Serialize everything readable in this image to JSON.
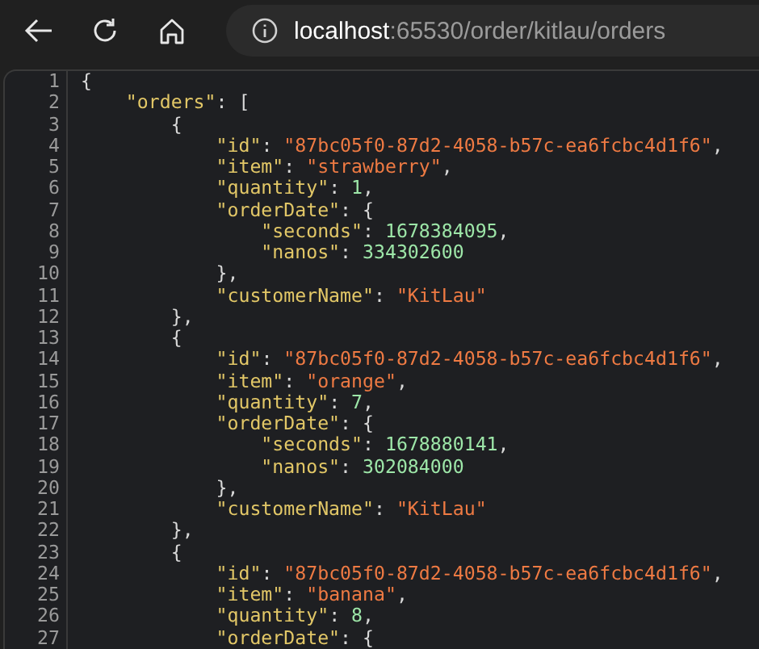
{
  "address_bar": {
    "host": "localhost",
    "path": ":65530/order/kitlau/orders"
  },
  "code_lines": [
    {
      "number": "1",
      "tokens": [
        {
          "kind": "punct",
          "text": "{"
        }
      ]
    },
    {
      "number": "2",
      "tokens": [
        {
          "kind": "key",
          "text": "    \"orders\""
        },
        {
          "kind": "punct",
          "text": ": ["
        }
      ]
    },
    {
      "number": "3",
      "tokens": [
        {
          "kind": "punct",
          "text": "        {"
        }
      ]
    },
    {
      "number": "4",
      "tokens": [
        {
          "kind": "key",
          "text": "            \"id\""
        },
        {
          "kind": "punct",
          "text": ": "
        },
        {
          "kind": "string",
          "text": "\"87bc05f0-87d2-4058-b57c-ea6fcbc4d1f6\""
        },
        {
          "kind": "punct",
          "text": ","
        }
      ]
    },
    {
      "number": "5",
      "tokens": [
        {
          "kind": "key",
          "text": "            \"item\""
        },
        {
          "kind": "punct",
          "text": ": "
        },
        {
          "kind": "string",
          "text": "\"strawberry\""
        },
        {
          "kind": "punct",
          "text": ","
        }
      ]
    },
    {
      "number": "6",
      "tokens": [
        {
          "kind": "key",
          "text": "            \"quantity\""
        },
        {
          "kind": "punct",
          "text": ": "
        },
        {
          "kind": "number",
          "text": "1"
        },
        {
          "kind": "punct",
          "text": ","
        }
      ]
    },
    {
      "number": "7",
      "tokens": [
        {
          "kind": "key",
          "text": "            \"orderDate\""
        },
        {
          "kind": "punct",
          "text": ": {"
        }
      ]
    },
    {
      "number": "8",
      "tokens": [
        {
          "kind": "key",
          "text": "                \"seconds\""
        },
        {
          "kind": "punct",
          "text": ": "
        },
        {
          "kind": "number",
          "text": "1678384095"
        },
        {
          "kind": "punct",
          "text": ","
        }
      ]
    },
    {
      "number": "9",
      "tokens": [
        {
          "kind": "key",
          "text": "                \"nanos\""
        },
        {
          "kind": "punct",
          "text": ": "
        },
        {
          "kind": "number",
          "text": "334302600"
        }
      ]
    },
    {
      "number": "10",
      "tokens": [
        {
          "kind": "punct",
          "text": "            },"
        }
      ]
    },
    {
      "number": "11",
      "tokens": [
        {
          "kind": "key",
          "text": "            \"customerName\""
        },
        {
          "kind": "punct",
          "text": ": "
        },
        {
          "kind": "string",
          "text": "\"KitLau\""
        }
      ]
    },
    {
      "number": "12",
      "tokens": [
        {
          "kind": "punct",
          "text": "        },"
        }
      ]
    },
    {
      "number": "13",
      "tokens": [
        {
          "kind": "punct",
          "text": "        {"
        }
      ]
    },
    {
      "number": "14",
      "tokens": [
        {
          "kind": "key",
          "text": "            \"id\""
        },
        {
          "kind": "punct",
          "text": ": "
        },
        {
          "kind": "string",
          "text": "\"87bc05f0-87d2-4058-b57c-ea6fcbc4d1f6\""
        },
        {
          "kind": "punct",
          "text": ","
        }
      ]
    },
    {
      "number": "15",
      "tokens": [
        {
          "kind": "key",
          "text": "            \"item\""
        },
        {
          "kind": "punct",
          "text": ": "
        },
        {
          "kind": "string",
          "text": "\"orange\""
        },
        {
          "kind": "punct",
          "text": ","
        }
      ]
    },
    {
      "number": "16",
      "tokens": [
        {
          "kind": "key",
          "text": "            \"quantity\""
        },
        {
          "kind": "punct",
          "text": ": "
        },
        {
          "kind": "number",
          "text": "7"
        },
        {
          "kind": "punct",
          "text": ","
        }
      ]
    },
    {
      "number": "17",
      "tokens": [
        {
          "kind": "key",
          "text": "            \"orderDate\""
        },
        {
          "kind": "punct",
          "text": ": {"
        }
      ]
    },
    {
      "number": "18",
      "tokens": [
        {
          "kind": "key",
          "text": "                \"seconds\""
        },
        {
          "kind": "punct",
          "text": ": "
        },
        {
          "kind": "number",
          "text": "1678880141"
        },
        {
          "kind": "punct",
          "text": ","
        }
      ]
    },
    {
      "number": "19",
      "tokens": [
        {
          "kind": "key",
          "text": "                \"nanos\""
        },
        {
          "kind": "punct",
          "text": ": "
        },
        {
          "kind": "number",
          "text": "302084000"
        }
      ]
    },
    {
      "number": "20",
      "tokens": [
        {
          "kind": "punct",
          "text": "            },"
        }
      ]
    },
    {
      "number": "21",
      "tokens": [
        {
          "kind": "key",
          "text": "            \"customerName\""
        },
        {
          "kind": "punct",
          "text": ": "
        },
        {
          "kind": "string",
          "text": "\"KitLau\""
        }
      ]
    },
    {
      "number": "22",
      "tokens": [
        {
          "kind": "punct",
          "text": "        },"
        }
      ]
    },
    {
      "number": "23",
      "tokens": [
        {
          "kind": "punct",
          "text": "        {"
        }
      ]
    },
    {
      "number": "24",
      "tokens": [
        {
          "kind": "key",
          "text": "            \"id\""
        },
        {
          "kind": "punct",
          "text": ": "
        },
        {
          "kind": "string",
          "text": "\"87bc05f0-87d2-4058-b57c-ea6fcbc4d1f6\""
        },
        {
          "kind": "punct",
          "text": ","
        }
      ]
    },
    {
      "number": "25",
      "tokens": [
        {
          "kind": "key",
          "text": "            \"item\""
        },
        {
          "kind": "punct",
          "text": ": "
        },
        {
          "kind": "string",
          "text": "\"banana\""
        },
        {
          "kind": "punct",
          "text": ","
        }
      ]
    },
    {
      "number": "26",
      "tokens": [
        {
          "kind": "key",
          "text": "            \"quantity\""
        },
        {
          "kind": "punct",
          "text": ": "
        },
        {
          "kind": "number",
          "text": "8"
        },
        {
          "kind": "punct",
          "text": ","
        }
      ]
    },
    {
      "number": "27",
      "tokens": [
        {
          "kind": "key",
          "text": "            \"orderDate\""
        },
        {
          "kind": "punct",
          "text": ": {"
        }
      ]
    }
  ]
}
